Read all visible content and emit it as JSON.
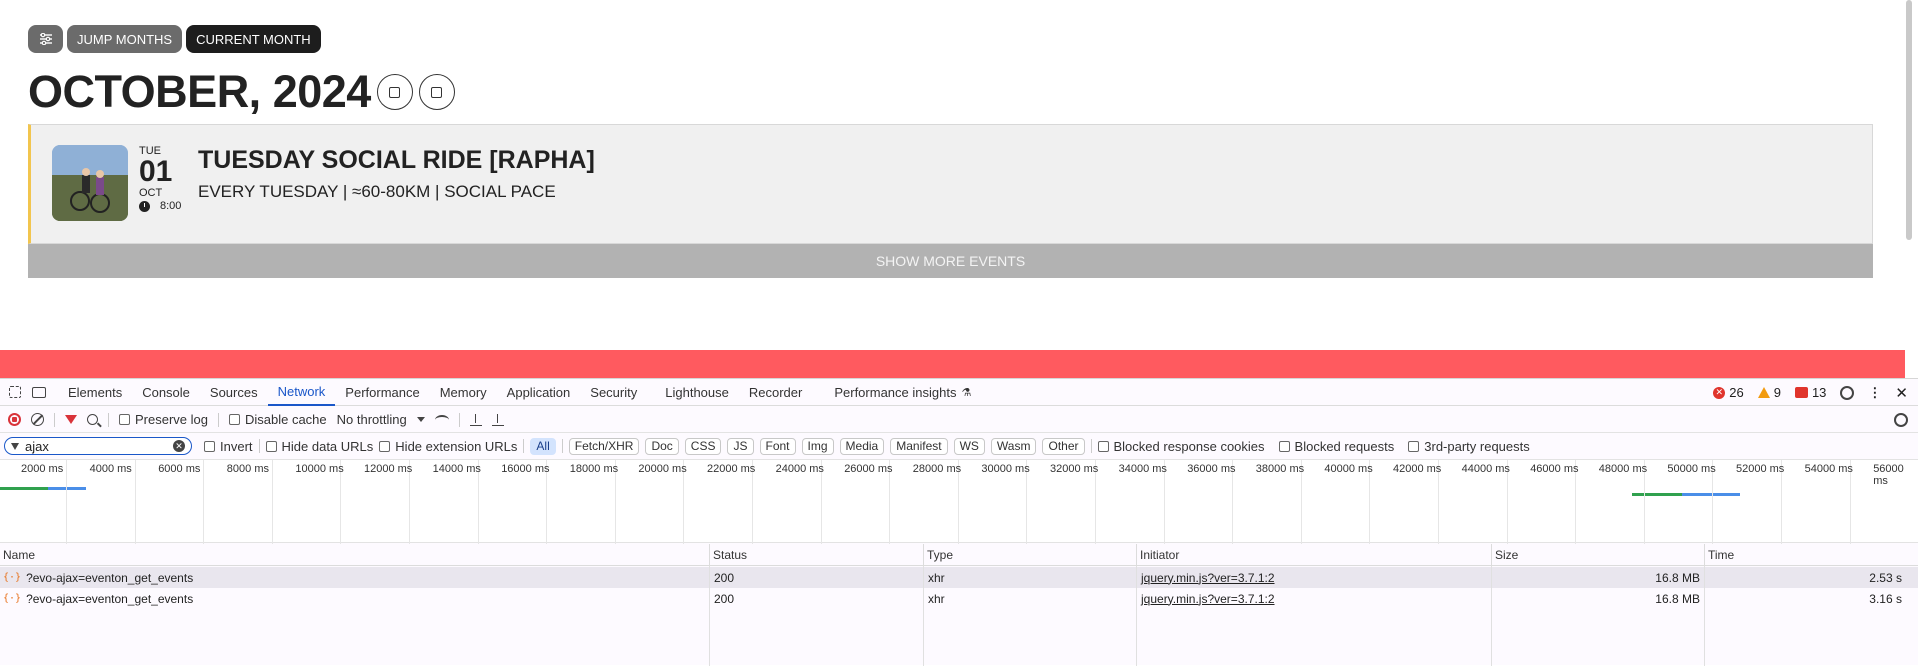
{
  "page": {
    "toolbar": {
      "jump_months": "JUMP MONTHS",
      "current_month": "CURRENT MONTH"
    },
    "month_title": "OCTOBER, 2024",
    "event": {
      "day": "TUE",
      "date": "01",
      "month": "OCT",
      "time": "8:00",
      "title": "TUESDAY SOCIAL RIDE [RAPHA]",
      "subtitle": "EVERY TUESDAY | ≈60-80KM | SOCIAL PACE"
    },
    "show_more": "SHOW MORE EVENTS",
    "colors": {
      "accent_border": "#f2c54e",
      "red_bar": "#ff5a5f"
    }
  },
  "devtools": {
    "tabs": [
      "Elements",
      "Console",
      "Sources",
      "Network",
      "Performance",
      "Memory",
      "Application",
      "Security",
      "Lighthouse",
      "Recorder",
      "Performance insights"
    ],
    "active_tab": "Network",
    "badges": {
      "errors": "26",
      "warnings": "9",
      "issues": "13"
    },
    "toolbar": {
      "preserve_log": "Preserve log",
      "disable_cache": "Disable cache",
      "throttling": "No throttling"
    },
    "filter": {
      "value": "ajax",
      "invert": "Invert",
      "hide_data_urls": "Hide data URLs",
      "hide_extension_urls": "Hide extension URLs",
      "types": [
        "All",
        "Fetch/XHR",
        "Doc",
        "CSS",
        "JS",
        "Font",
        "Img",
        "Media",
        "Manifest",
        "WS",
        "Wasm",
        "Other"
      ],
      "blocked_response_cookies": "Blocked response cookies",
      "blocked_requests": "Blocked requests",
      "third_party": "3rd-party requests"
    },
    "timeline_labels": [
      "2000 ms",
      "4000 ms",
      "6000 ms",
      "8000 ms",
      "10000 ms",
      "12000 ms",
      "14000 ms",
      "16000 ms",
      "18000 ms",
      "20000 ms",
      "22000 ms",
      "24000 ms",
      "26000 ms",
      "28000 ms",
      "30000 ms",
      "32000 ms",
      "34000 ms",
      "36000 ms",
      "38000 ms",
      "40000 ms",
      "42000 ms",
      "44000 ms",
      "46000 ms",
      "48000 ms",
      "50000 ms",
      "52000 ms",
      "54000 ms",
      "56000 ms"
    ],
    "columns": [
      "Name",
      "Status",
      "Type",
      "Initiator",
      "Size",
      "Time"
    ],
    "rows": [
      {
        "name": "?evo-ajax=eventon_get_events",
        "status": "200",
        "type": "xhr",
        "initiator": "jquery.min.js?ver=3.7.1:2",
        "size": "16.8 MB",
        "time": "2.53 s"
      },
      {
        "name": "?evo-ajax=eventon_get_events",
        "status": "200",
        "type": "xhr",
        "initiator": "jquery.min.js?ver=3.7.1:2",
        "size": "16.8 MB",
        "time": "3.16 s"
      }
    ]
  }
}
